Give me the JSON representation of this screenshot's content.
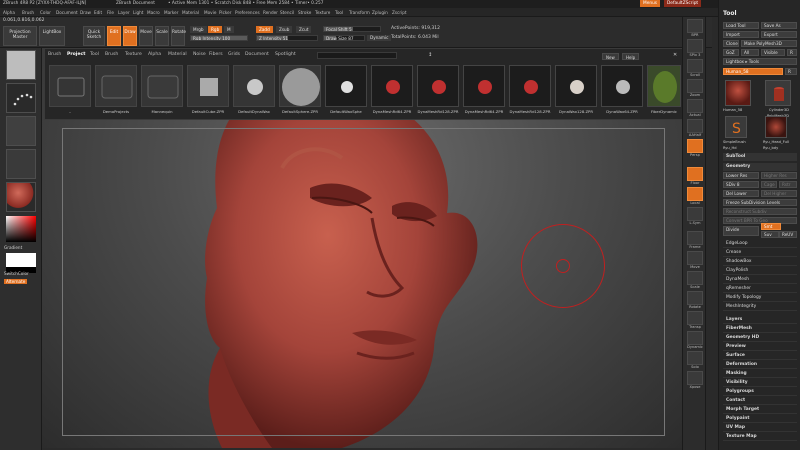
{
  "titlebar": {
    "app": "ZBrush 4R8 P2 [ZYXX-THDQ-AFAF-ILJN]",
    "doc": "ZBrush Document",
    "mem": "• Active Mem 1301 • Scratch Disk 848 • Free Mem 2584 • Timer• 0.257",
    "menus_btn": "Menus",
    "script_btn": "DefaultZScript"
  },
  "menubar": [
    "Alpha",
    "Brush",
    "Color",
    "Document",
    "Draw",
    "Edit",
    "File",
    "Layer",
    "Light",
    "Macro",
    "Marker",
    "Material",
    "Movie",
    "Picker",
    "Preferences",
    "Render",
    "Stencil",
    "Stroke",
    "Texture",
    "Tool",
    "Transform",
    "Zplugin",
    "Zscript"
  ],
  "coords": "0.061,0.816,0.062",
  "shelf": {
    "projection_master": "Projection Master",
    "lightbox": "LightBox",
    "quick_sketch": "Quick Sketch",
    "edit": "Edit",
    "draw": "Draw",
    "move": "Move",
    "scale": "Scale",
    "rotate": "Rotate",
    "mrgb": "Mrgb",
    "rgb": "Rgb",
    "m": "M",
    "zadd": "Zadd",
    "zsub": "Zsub",
    "zcut": "Zcut",
    "rgb_intensity": "Rgb Intensity 100",
    "z_intensity": "Z Intensity 51",
    "focal_shift": "Focal Shift 5",
    "draw_size": "Draw Size 87",
    "active_points": "ActivePoints: 919,312",
    "total_points": "TotalPoints: 6.043 Mil",
    "dynamic": "Dynamic"
  },
  "popup": {
    "tabs": [
      "Brush",
      "Project",
      "Tool",
      "Brush",
      "Texture",
      "Alpha",
      "Material",
      "Noise",
      "Fibers",
      "Grids",
      "Document",
      "Spotlight"
    ],
    "active_tab": "Project",
    "new_btn": "New",
    "help_btn": "Help",
    "thumbs": [
      {
        "label": ".."
      },
      {
        "label": "DemoProjects"
      },
      {
        "label": "Mannequin"
      },
      {
        "label": "DefaultCube.ZPR"
      },
      {
        "label": "DefaultDynaWax"
      },
      {
        "label": "DefaultSphere.ZPR"
      },
      {
        "label": "DefaultWaxSphe"
      },
      {
        "label": "DynaMeshRd64.ZPR"
      },
      {
        "label": "DynaMeshRd128.ZPR"
      },
      {
        "label": "DynaMeshRd64.ZPR"
      },
      {
        "label": "DynaMeshRd128.ZPR"
      },
      {
        "label": "DynaWax128.ZPR"
      },
      {
        "label": "DynaWax64.ZPR"
      },
      {
        "label": "FiberDynamic"
      }
    ]
  },
  "left": {
    "gradient": "Gradient",
    "switch_color": "SwitchColor",
    "alternate": "Alternate"
  },
  "right_shelf": [
    "BPR",
    "SPix 3",
    "Scroll",
    "Zoom",
    "Actual",
    "AAHalf",
    "Persp",
    "Floor",
    "Local",
    "L.Sym",
    "Frame",
    "Move",
    "Scale",
    "Rotate",
    "Transp",
    "Dynamic",
    "Solo",
    "Xpose"
  ],
  "tray": {
    "title": "Tool",
    "buttons": [
      "Load Tool",
      "Save As",
      "Import",
      "Export",
      "Clone",
      "Make PolyMesh3D",
      "GoZ",
      "All",
      "Visible",
      "R",
      "Lightbox ▸ Tools",
      "Human_58",
      "R"
    ],
    "tool_names": [
      "Human_58",
      "Cylinder3D",
      "PolyMesh3D",
      "SimpleBrush",
      "Ryu_Head_Full",
      "Ryu_Hd",
      "Ryu_bdy"
    ],
    "subtool": "SubTool",
    "geometry": "Geometry",
    "lower_res": "Lower Res",
    "higher_res": "Higher Res",
    "sdiv": "SDiv 8",
    "cage": "Cage",
    "rstr": "Rstr",
    "del_lower": "Del Lower",
    "del_higher": "Del Higher",
    "freeze": "Freeze SubDivision Levels",
    "reconstruct": "Reconstruct Subdiv",
    "convert": "Convert BPR To Geo",
    "divide": "Divide",
    "smt": "Smt",
    "suv": "Suv",
    "reuv": "ReUV",
    "subitems": [
      "EdgeLoop",
      "Crease",
      "ShadowBox",
      "ClayPolish",
      "DynaMesh",
      "qRemesher",
      "Modify Topology",
      "MeshIntegrity"
    ],
    "sections": [
      "Layers",
      "FiberMesh",
      "Geometry HD",
      "Preview",
      "Surface",
      "Deformation",
      "Masking",
      "Visibility",
      "Polygroups",
      "Contact",
      "Morph Target",
      "Polypaint",
      "UV Map",
      "Texture Map"
    ]
  }
}
